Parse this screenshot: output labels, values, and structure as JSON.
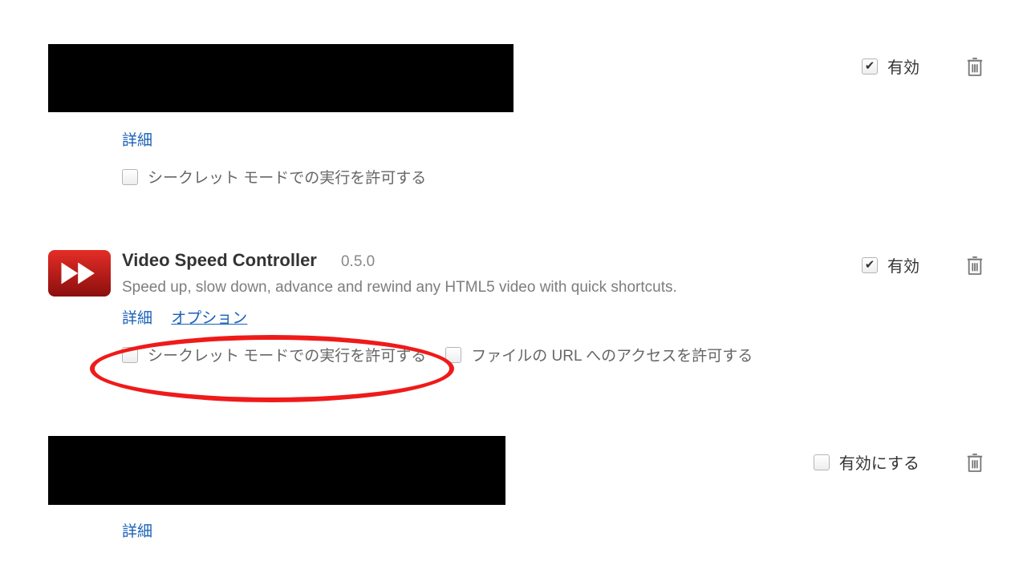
{
  "labels": {
    "enabled": "有効",
    "enable": "有効にする",
    "details": "詳細",
    "options": "オプション",
    "allow_incognito": "シークレット モードでの実行を許可する",
    "allow_file_urls": "ファイルの URL へのアクセスを許可する"
  },
  "extensions": [
    {
      "name_hidden": true,
      "enabled_checked": true,
      "enable_label_key": "enabled",
      "show_options": false,
      "show_file_url_perm": false
    },
    {
      "name": "Video Speed Controller",
      "version": "0.5.0",
      "description": "Speed up, slow down, advance and rewind any HTML5 video with quick shortcuts.",
      "enabled_checked": true,
      "enable_label_key": "enabled",
      "show_options": true,
      "show_file_url_perm": true,
      "icon": "video-speed-controller"
    },
    {
      "name_hidden": true,
      "enabled_checked": false,
      "enable_label_key": "enable",
      "show_options": false,
      "show_file_url_perm": false
    }
  ],
  "annotation": {
    "highlight_incognito_permission": true
  }
}
